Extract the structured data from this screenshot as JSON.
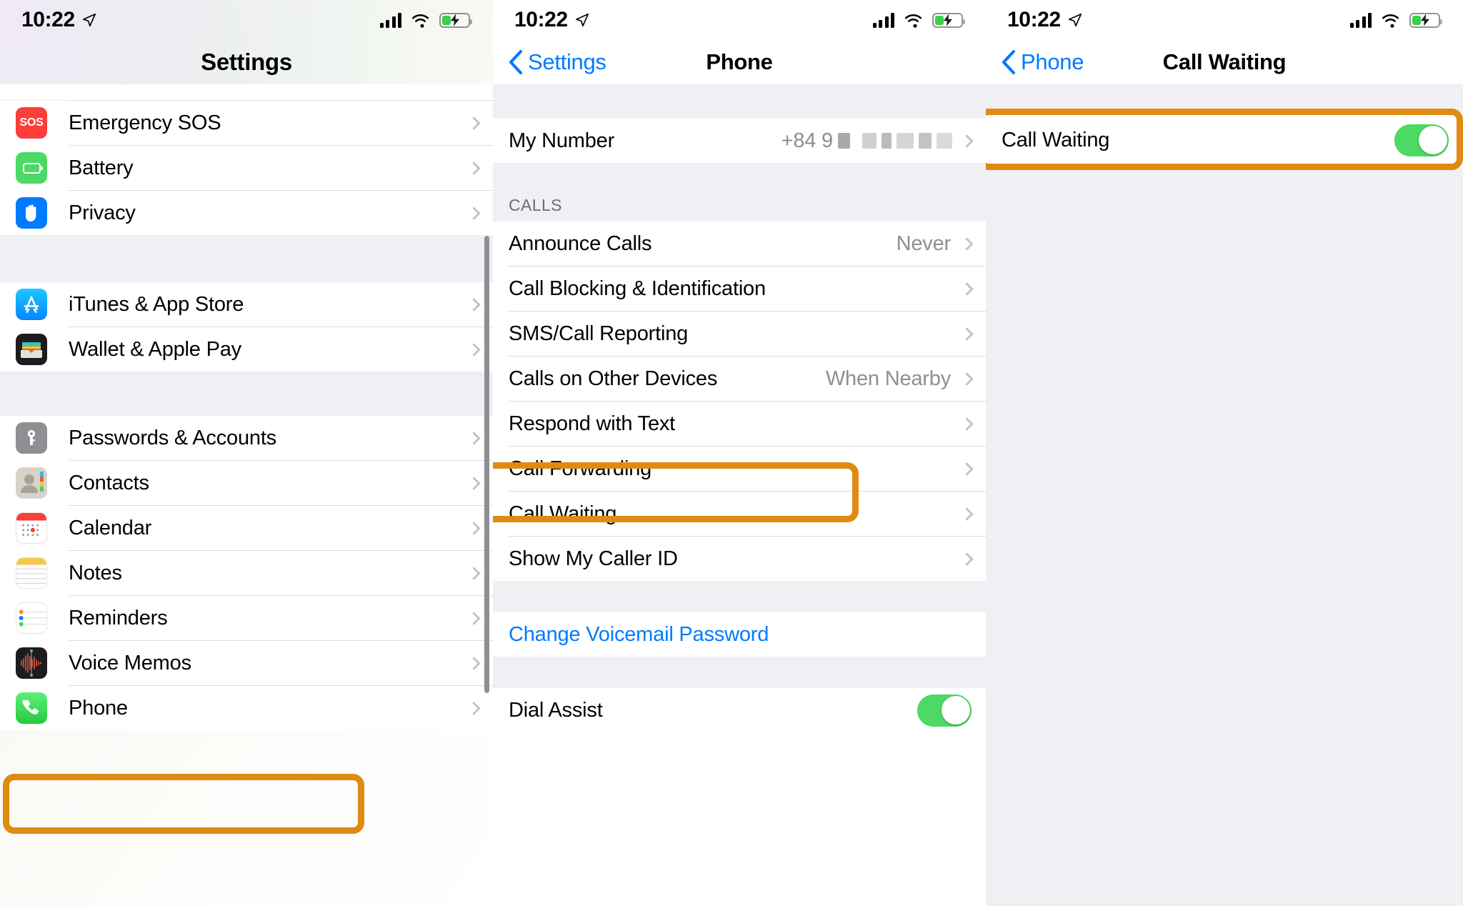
{
  "status_bar": {
    "time": "10:22",
    "location_icon": "location-arrow-icon",
    "signal_icon": "cellular-bars-icon",
    "wifi_icon": "wifi-icon",
    "battery_icon": "battery-charging-icon"
  },
  "colors": {
    "highlight": "#e08a12",
    "accent_blue": "#007aff",
    "toggle_green": "#4cd964",
    "group_bg": "#efeff4",
    "value_gray": "#8e8e93"
  },
  "panel1": {
    "title": "Settings",
    "groups": [
      {
        "items": [
          {
            "label": "Emergency SOS",
            "icon": "emergency-sos-icon",
            "accessory": "chevron"
          },
          {
            "label": "Battery",
            "icon": "battery-app-icon",
            "accessory": "chevron"
          },
          {
            "label": "Privacy",
            "icon": "privacy-hand-icon",
            "accessory": "chevron"
          }
        ]
      },
      {
        "items": [
          {
            "label": "iTunes & App Store",
            "icon": "app-store-icon",
            "accessory": "chevron"
          },
          {
            "label": "Wallet & Apple Pay",
            "icon": "wallet-icon",
            "accessory": "chevron"
          }
        ]
      },
      {
        "items": [
          {
            "label": "Passwords & Accounts",
            "icon": "passwords-key-icon",
            "accessory": "chevron"
          },
          {
            "label": "Contacts",
            "icon": "contacts-icon",
            "accessory": "chevron"
          },
          {
            "label": "Calendar",
            "icon": "calendar-icon",
            "accessory": "chevron"
          },
          {
            "label": "Notes",
            "icon": "notes-icon",
            "accessory": "chevron"
          },
          {
            "label": "Reminders",
            "icon": "reminders-icon",
            "accessory": "chevron"
          },
          {
            "label": "Voice Memos",
            "icon": "voice-memos-icon",
            "accessory": "chevron"
          },
          {
            "label": "Phone",
            "icon": "phone-icon",
            "accessory": "chevron",
            "highlighted": true
          }
        ]
      }
    ]
  },
  "panel2": {
    "back_label": "Settings",
    "title": "Phone",
    "my_number": {
      "label": "My Number",
      "value_prefix": "+84 9",
      "value_masked": true
    },
    "calls_section_header": "CALLS",
    "calls_items": [
      {
        "label": "Announce Calls",
        "value": "Never"
      },
      {
        "label": "Call Blocking & Identification",
        "value": ""
      },
      {
        "label": "SMS/Call Reporting",
        "value": ""
      },
      {
        "label": "Calls on Other Devices",
        "value": "When Nearby"
      },
      {
        "label": "Respond with Text",
        "value": ""
      },
      {
        "label": "Call Forwarding",
        "value": ""
      },
      {
        "label": "Call Waiting",
        "value": "",
        "highlighted": true
      },
      {
        "label": "Show My Caller ID",
        "value": ""
      }
    ],
    "voicemail_action": "Change Voicemail Password",
    "dial_assist": {
      "label": "Dial Assist",
      "enabled": true
    }
  },
  "panel3": {
    "back_label": "Phone",
    "title": "Call Waiting",
    "row": {
      "label": "Call Waiting",
      "enabled": true,
      "highlighted": true
    }
  }
}
